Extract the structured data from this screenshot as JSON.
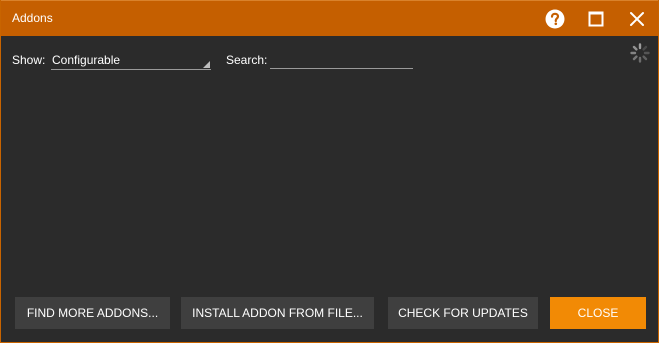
{
  "window": {
    "title": "Addons"
  },
  "titlebar": {
    "help_icon": "help-circle-icon",
    "maximize_icon": "maximize-icon",
    "close_icon": "close-icon"
  },
  "filters": {
    "show_label": "Show:",
    "show_selected": "Configurable",
    "search_label": "Search:",
    "search_value": "",
    "search_placeholder": ""
  },
  "status": {
    "spinner_icon": "loading-spinner-icon"
  },
  "buttons": {
    "find_more": "FIND MORE ADDONS...",
    "install_from_file": "INSTALL ADDON FROM FILE...",
    "check_updates": "CHECK FOR UPDATES",
    "close": "CLOSE"
  },
  "colors": {
    "titlebar": "#c55f00",
    "background": "#2b2b2b",
    "button": "#3f3f3f",
    "accent_button": "#f28a05",
    "text": "#ffffff"
  }
}
